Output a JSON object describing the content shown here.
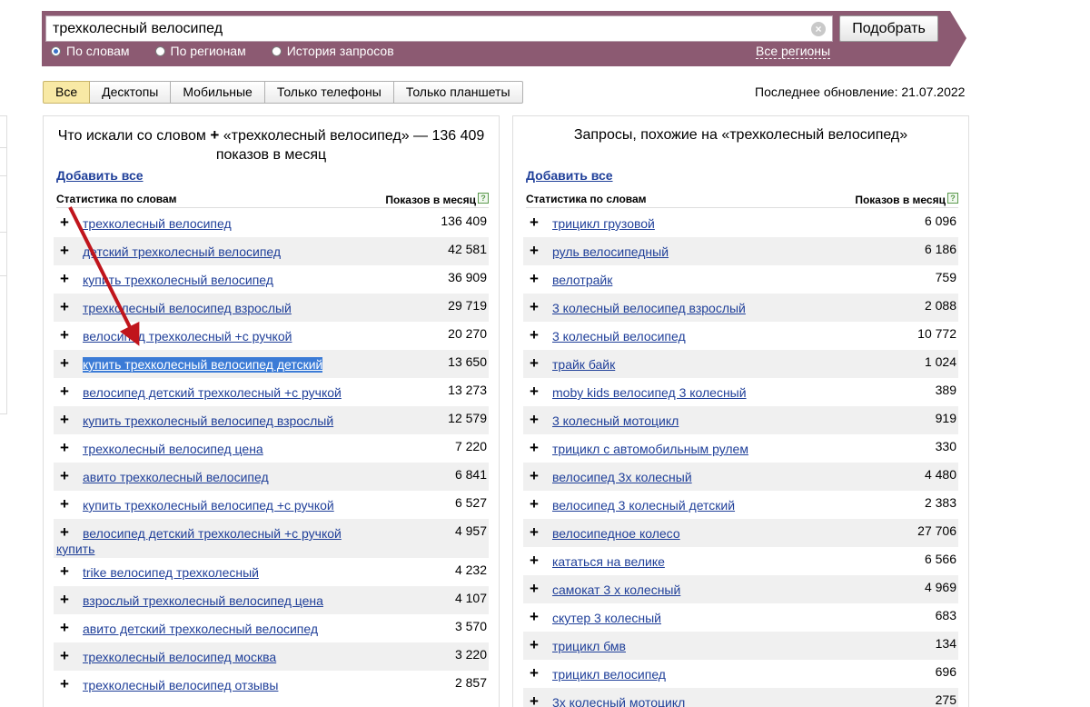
{
  "search": {
    "query": "трехколесный велосипед",
    "button": "Подобрать",
    "modes": [
      {
        "label": "По словам",
        "selected": true
      },
      {
        "label": "По регионам",
        "selected": false
      },
      {
        "label": "История запросов",
        "selected": false
      }
    ],
    "regions_link": "Все регионы"
  },
  "device_tabs": [
    {
      "label": "Все",
      "active": true
    },
    {
      "label": "Десктопы",
      "active": false
    },
    {
      "label": "Мобильные",
      "active": false
    },
    {
      "label": "Только телефоны",
      "active": false
    },
    {
      "label": "Только планшеты",
      "active": false
    }
  ],
  "last_update": "Последнее обновление: 21.07.2022",
  "left_panel": {
    "title_prefix": "Что искали со словом",
    "title_plus": "+",
    "title_rest": "«трехколесный велосипед» — 136 409 показов в месяц",
    "add_all": "Добавить все",
    "col_words": "Статистика по словам",
    "col_shows": "Показов в месяц",
    "rows": [
      {
        "phrase": "трехколесный велосипед",
        "count": "136 409"
      },
      {
        "phrase": "детский трехколесный велосипед",
        "count": "42 581"
      },
      {
        "phrase": "купить трехколесный велосипед",
        "count": "36 909"
      },
      {
        "phrase": "трехколесный велосипед взрослый",
        "count": "29 719"
      },
      {
        "phrase": "велосипед трехколесный +с ручкой",
        "count": "20 270"
      },
      {
        "phrase": "купить трехколесный велосипед детский",
        "count": "13 650",
        "selected": true
      },
      {
        "phrase": "велосипед детский трехколесный +с ручкой",
        "count": "13 273"
      },
      {
        "phrase": "купить трехколесный велосипед взрослый",
        "count": "12 579"
      },
      {
        "phrase": "трехколесный велосипед цена",
        "count": "7 220"
      },
      {
        "phrase": "авито трехколесный велосипед",
        "count": "6 841"
      },
      {
        "phrase": "купить трехколесный велосипед +с ручкой",
        "count": "6 527"
      },
      {
        "phrase": "велосипед детский трехколесный +с ручкой купить",
        "count": "4 957",
        "tall": true
      },
      {
        "phrase": "trike велосипед трехколесный",
        "count": "4 232"
      },
      {
        "phrase": "взрослый трехколесный велосипед цена",
        "count": "4 107"
      },
      {
        "phrase": "авито детский трехколесный велосипед",
        "count": "3 570"
      },
      {
        "phrase": "трехколесный велосипед москва",
        "count": "3 220"
      },
      {
        "phrase": "трехколесный велосипед отзывы",
        "count": "2 857"
      }
    ]
  },
  "right_panel": {
    "title": "Запросы, похожие на «трехколесный велосипед»",
    "add_all": "Добавить все",
    "col_words": "Статистика по словам",
    "col_shows": "Показов в месяц",
    "rows": [
      {
        "phrase": "трицикл грузовой",
        "count": "6 096"
      },
      {
        "phrase": "руль велосипедный",
        "count": "6 186"
      },
      {
        "phrase": "велотрайк",
        "count": "759"
      },
      {
        "phrase": "3 колесный велосипед взрослый",
        "count": "2 088"
      },
      {
        "phrase": "3 колесный велосипед",
        "count": "10 772"
      },
      {
        "phrase": "трайк байк",
        "count": "1 024"
      },
      {
        "phrase": "moby kids велосипед 3 колесный",
        "count": "389"
      },
      {
        "phrase": "3 колесный мотоцикл",
        "count": "919"
      },
      {
        "phrase": "трицикл с автомобильным рулем",
        "count": "330"
      },
      {
        "phrase": "велосипед 3х колесный",
        "count": "4 480"
      },
      {
        "phrase": "велосипед 3 колесный детский",
        "count": "2 383"
      },
      {
        "phrase": "велосипедное колесо",
        "count": "27 706"
      },
      {
        "phrase": "кататься на велике",
        "count": "6 566"
      },
      {
        "phrase": "самокат 3 х колесный",
        "count": "4 969"
      },
      {
        "phrase": "скутер 3 колесный",
        "count": "683"
      },
      {
        "phrase": "трицикл бмв",
        "count": "134"
      },
      {
        "phrase": "трицикл велосипед",
        "count": "696"
      },
      {
        "phrase": "3х колесный мотоцикл",
        "count": "275"
      }
    ]
  },
  "annotation": {
    "color": "#c0151c"
  }
}
